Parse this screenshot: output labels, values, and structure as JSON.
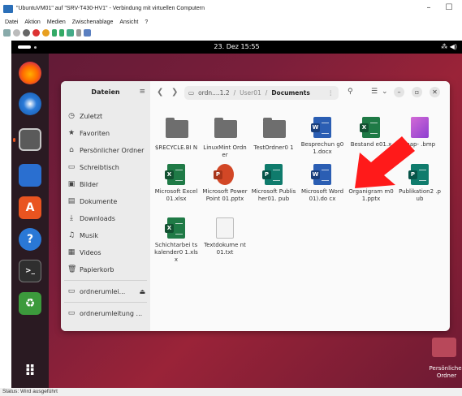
{
  "host": {
    "title": "\"UbuntuVM01\" auf \"SRV-T430-HV1\" - Verbindung mit virtuellen Computern",
    "minimize": "–",
    "maximize": "☐",
    "menu": [
      "Datei",
      "Aktion",
      "Medien",
      "Zwischenablage",
      "Ansicht",
      "?"
    ],
    "status": "Status: Wird ausgeführt"
  },
  "topbar": {
    "clock": "23. Dez  15:55",
    "sys_icons": "⁂ ◀)"
  },
  "files_window": {
    "sidebar_title": "Dateien",
    "sidebar_menu": "≡",
    "sidebar_items": [
      {
        "label": "Zuletzt",
        "icon": "clock-icon",
        "glyph": "◷"
      },
      {
        "label": "Favoriten",
        "icon": "star-icon",
        "glyph": "★"
      },
      {
        "label": "Persönlicher Ordner",
        "icon": "home-icon",
        "glyph": "⌂"
      },
      {
        "label": "Schreibtisch",
        "icon": "desktop-icon",
        "glyph": "▭"
      },
      {
        "label": "Bilder",
        "icon": "image-icon",
        "glyph": "▣"
      },
      {
        "label": "Dokumente",
        "icon": "document-icon",
        "glyph": "▤"
      },
      {
        "label": "Downloads",
        "icon": "download-icon",
        "glyph": "⤓"
      },
      {
        "label": "Musik",
        "icon": "music-icon",
        "glyph": "♫"
      },
      {
        "label": "Videos",
        "icon": "video-icon",
        "glyph": "▦"
      },
      {
        "label": "Papierkorb",
        "icon": "trash-icon",
        "glyph": "🗑"
      }
    ],
    "drives": [
      {
        "label": "ordnerumlei...",
        "eject": "⏏",
        "icon": "drive-icon"
      },
      {
        "label": "ordnerumleitung ...",
        "icon": "drive-icon"
      }
    ],
    "path": {
      "root": "ordn....1.2",
      "sep1": "/",
      "middle": "User01",
      "sep2": "/",
      "current": "Documents",
      "menu": "⋮"
    },
    "files": [
      {
        "name": "$RECYCLE.BIN",
        "type": "folder"
      },
      {
        "name": "LinuxMint Ordner",
        "type": "folder"
      },
      {
        "name": "TestOrdner01",
        "type": "folder"
      },
      {
        "name": "Besprechung01.docx",
        "type": "word",
        "badge": "W"
      },
      {
        "name": "Bestandsliste01.xlsx",
        "type": "excel",
        "badge": "X"
      },
      {
        "name": "Bitmap-Grafik.bmp",
        "type": "image"
      },
      {
        "name": "Microsoft Excel01.xlsx",
        "type": "excel",
        "badge": "X"
      },
      {
        "name": "Microsoft PowerPoint 01.pptx",
        "type": "powerpoint",
        "badge": "P"
      },
      {
        "name": "Microsoft Publisher01.pub",
        "type": "publisher",
        "badge": "P"
      },
      {
        "name": "Microsoft Word01).docx",
        "type": "word",
        "badge": "W"
      },
      {
        "name": "Organigramm01.pptx",
        "type": "powerpoint",
        "badge": "P"
      },
      {
        "name": "Publikation2.pub",
        "type": "publisher",
        "badge": "P"
      },
      {
        "name": "Schichtarbeitskalender01.xlsx",
        "type": "excel",
        "badge": "X"
      },
      {
        "name": "Textdokument01.txt",
        "type": "text"
      }
    ],
    "display_names": [
      "$RECYCLE.BI N",
      "LinuxMint Ordner",
      "TestOrdner0 1",
      "Besprechun g01.docx",
      "Bestand e01.x",
      "map- .bmp",
      "Microsoft Excel01.xlsx",
      "Microsoft PowerPoint 01.pptx",
      "Microsoft Publisher01. pub",
      "Microsoft Word01).do cx",
      "Organigram m01.pptx",
      "Publikation2 .pub",
      "Schichtarbei tskalender0 1.xlsx",
      "Textdokume nt01.txt"
    ]
  },
  "desktop": {
    "home_label": "Persönlicher Ordner"
  },
  "colors": {
    "word": "#2b5eb3",
    "excel": "#1f7a46",
    "powerpoint": "#d24726",
    "publisher": "#0f7b6c",
    "accent": "#e95420",
    "arrow": "#ff1a1a"
  }
}
